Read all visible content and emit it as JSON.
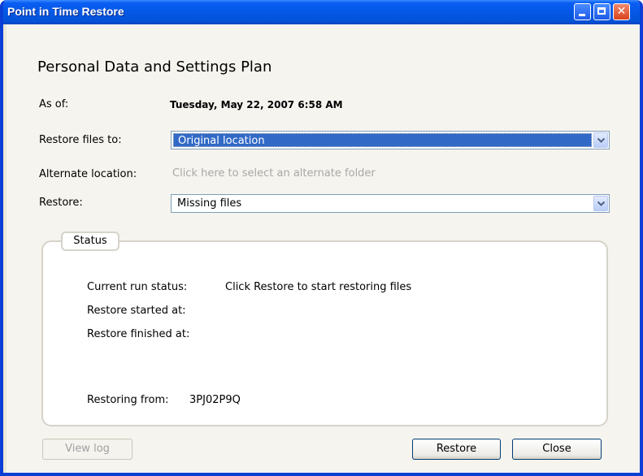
{
  "window": {
    "title": "Point in Time Restore",
    "controls": {
      "minimize": "_",
      "maximize": "□",
      "close": "✕"
    }
  },
  "heading": "Personal Data and Settings Plan",
  "fields": {
    "as_of_label": "As of:",
    "as_of_value": "Tuesday, May 22, 2007 6:58 AM",
    "restore_to_label": "Restore files to:",
    "restore_to_value": "Original location",
    "alternate_label": "Alternate location:",
    "alternate_link": "Click here to select an alternate folder",
    "restore_label": "Restore:",
    "restore_value": "Missing files"
  },
  "status": {
    "tab_label": "Status",
    "current_run_label": "Current run status:",
    "current_run_value": "Click Restore to start restoring files",
    "started_label": "Restore started at:",
    "finished_label": "Restore finished at:",
    "restoring_from_label": "Restoring from:",
    "restoring_from_value": "3PJ02P9Q"
  },
  "buttons": {
    "view_log": "View log",
    "restore": "Restore",
    "close": "Close"
  },
  "icons": {
    "minimize": "minimize-icon",
    "maximize": "maximize-icon",
    "close": "close-icon",
    "dropdown": "chevron-down-icon"
  },
  "colors": {
    "titlebar": "#0558e6",
    "selection": "#3169c6",
    "close_button": "#d9421c"
  }
}
